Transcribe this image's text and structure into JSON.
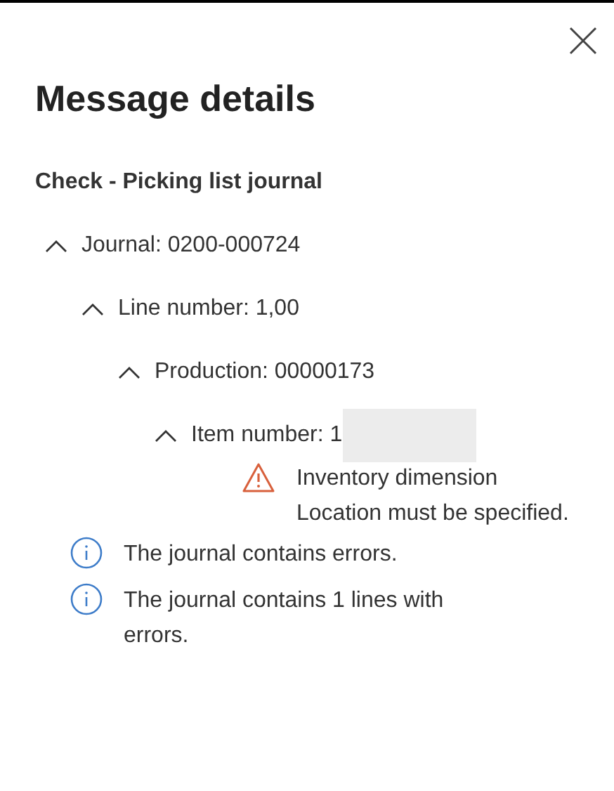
{
  "panel": {
    "title": "Message details",
    "subtitle": "Check - Picking list journal"
  },
  "tree": [
    {
      "label": "Journal: 0200-000724",
      "expanded": true,
      "children": [
        {
          "label": "Line number: 1,00",
          "expanded": true,
          "children": [
            {
              "label": "Production: 00000173",
              "expanded": true,
              "children": [
                {
                  "label": "Item number: 1",
                  "redacted": true,
                  "expanded": true,
                  "children": [
                    {
                      "kind": "warning",
                      "text": "Inventory dimension Location must be specified."
                    }
                  ]
                }
              ]
            }
          ]
        }
      ]
    }
  ],
  "messages": [
    {
      "kind": "info",
      "text": "The journal contains errors."
    },
    {
      "kind": "info",
      "text": "The journal contains 1 lines with errors."
    }
  ]
}
